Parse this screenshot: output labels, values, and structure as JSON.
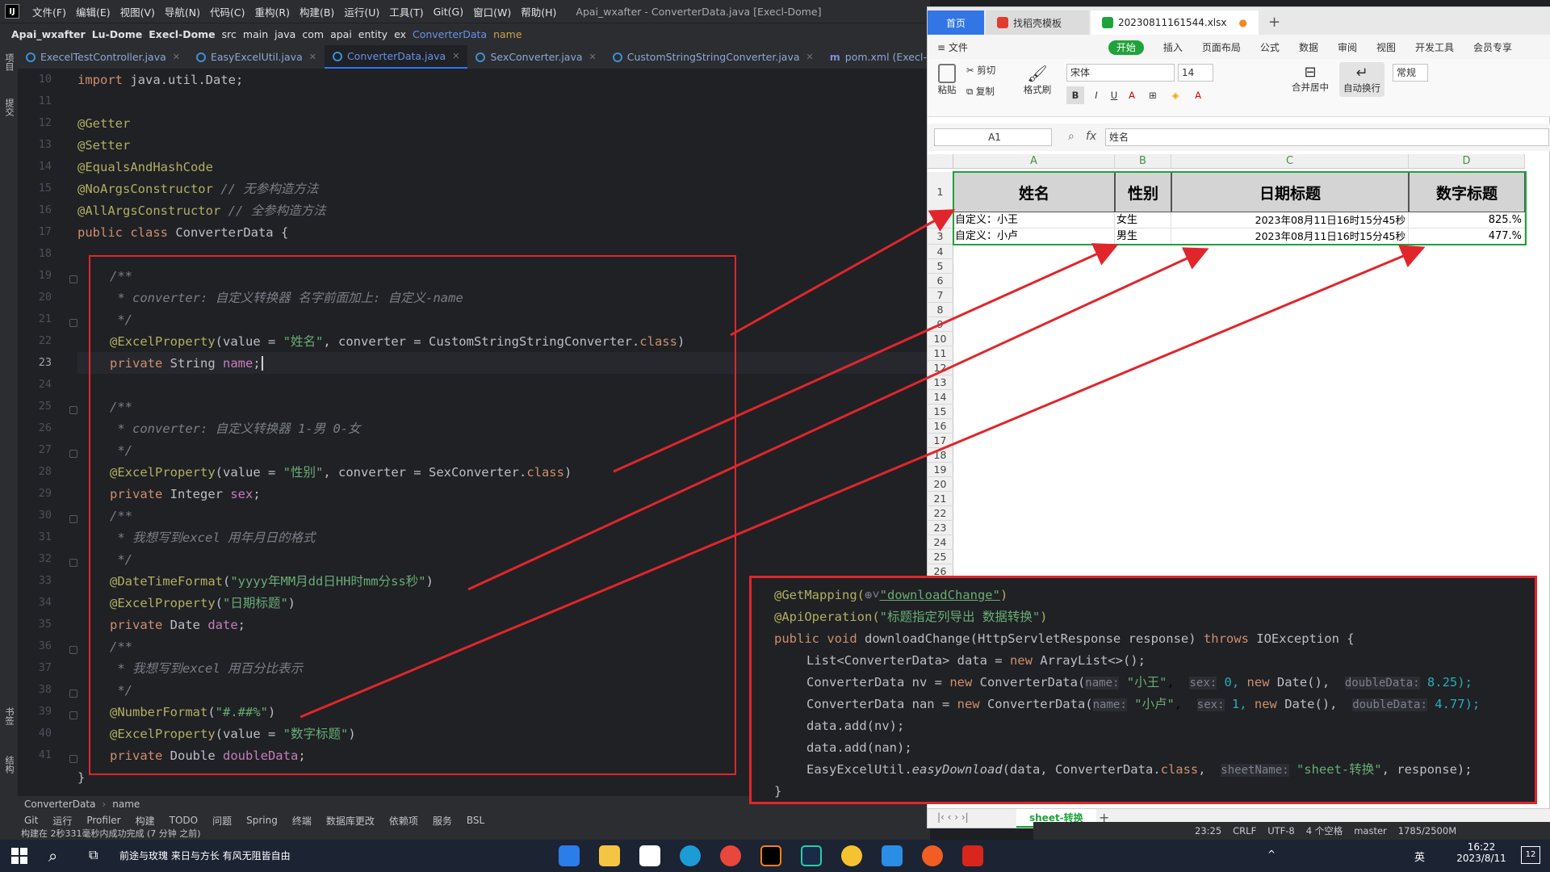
{
  "ide": {
    "logo": "IJ",
    "menu": [
      "文件(F)",
      "编辑(E)",
      "视图(V)",
      "导航(N)",
      "代码(C)",
      "重构(R)",
      "构建(B)",
      "运行(U)",
      "工具(T)",
      "Git(G)",
      "窗口(W)",
      "帮助(H)"
    ],
    "window_title": "Apai_wxafter - ConverterData.java [Execl-Dome]",
    "breadcrumbs": [
      "Apai_wxafter",
      "Lu-Dome",
      "Execl-Dome",
      "src",
      "main",
      "java",
      "com",
      "apai",
      "entity",
      "ex",
      "ConverterData",
      "name"
    ],
    "tabs": [
      "ExecelTestController.java",
      "EasyExcelUtil.java",
      "ConverterData.java",
      "SexConverter.java",
      "CustomStringStringConverter.java",
      "pom.xml (Execl-Dome)"
    ],
    "active_tab": "ConverterData.java",
    "left_tools": [
      "项目",
      "提交",
      "书签",
      "结构"
    ],
    "line_numbers": [
      "10",
      "11",
      "12",
      "13",
      "14",
      "15",
      "16",
      "17",
      "18",
      "19",
      "20",
      "21",
      "22",
      "23",
      "24",
      "25",
      "26",
      "27",
      "28",
      "29",
      "30",
      "31",
      "32",
      "33",
      "34",
      "35",
      "36",
      "37",
      "38",
      "39",
      "40",
      "41"
    ],
    "code": {
      "l10": {
        "kw": "import",
        "rest": " java.util.Date;"
      },
      "l12": "@Getter",
      "l13": "@Setter",
      "l14": "@EqualsAndHashCode",
      "l15a": "@NoArgsConstructor",
      "l15b": " // 无参构造方法",
      "l16a": "@AllArgsConstructor",
      "l16b": " // 全参构造方法",
      "l17a": "public class ",
      "l17b": "ConverterData {",
      "l19": "/**",
      "l20": " * converter: 自定义转换器 名字前面加上: 自定义-name",
      "l21": " */",
      "l22a": "@ExcelProperty",
      "l22b": "(value = ",
      "l22c": "\"姓名\"",
      "l22d": ", converter = ",
      "l22e": "CustomStringStringConverter.",
      "l22f": "class",
      "l22g": ")",
      "l23a": "private ",
      "l23b": "String ",
      "l23c": "name",
      "l23d": ";",
      "l25": "/**",
      "l26": " * converter: 自定义转换器 1-男 0-女",
      "l27": " */",
      "l28a": "@ExcelProperty",
      "l28b": "(value = ",
      "l28c": "\"性别\"",
      "l28d": ", converter = ",
      "l28e": "SexConverter.",
      "l28f": "class",
      "l28g": ")",
      "l29a": "private ",
      "l29b": "Integer ",
      "l29c": "sex",
      "l29d": ";",
      "l30": "/**",
      "l31": " * 我想写到excel 用年月日的格式",
      "l32": " */",
      "l33a": "@DateTimeFormat",
      "l33b": "(",
      "l33c": "\"yyyy年MM月dd日HH时mm分ss秒\"",
      "l33d": ")",
      "l34a": "@ExcelProperty",
      "l34b": "(",
      "l34c": "\"日期标题\"",
      "l34d": ")",
      "l35a": "private ",
      "l35b": "Date ",
      "l35c": "date",
      "l35d": ";",
      "l36": "/**",
      "l37": " * 我想写到excel 用百分比表示",
      "l38": " */",
      "l39a": "@NumberFormat",
      "l39b": "(",
      "l39c": "\"#.##%\"",
      "l39d": ")",
      "l40a": "@ExcelProperty",
      "l40b": "(value = ",
      "l40c": "\"数字标题\"",
      "l40d": ")",
      "l41a": "private ",
      "l41b": "Double ",
      "l41c": "doubleData",
      "l41d": ";",
      "l42": "}"
    },
    "bottom_breadcrumb": [
      "ConverterData",
      "name"
    ],
    "toolbar": [
      "Git",
      "运行",
      "Profiler",
      "构建",
      "TODO",
      "问题",
      "Spring",
      "终端",
      "数据库更改",
      "依赖项",
      "服务",
      "BSL"
    ],
    "status": "构建在 2秒331毫秒内成功完成 (7 分钟 之前)",
    "right_status": [
      "23:25",
      "CRLF",
      "UTF-8",
      "4 个空格",
      "master",
      "1785/2500M"
    ]
  },
  "wps": {
    "tabs": [
      "首页",
      "找稻壳模板",
      "20230811161544.xlsx"
    ],
    "menu": [
      "≡ 文件",
      "开始",
      "插入",
      "页面布局",
      "公式",
      "数据",
      "审阅",
      "视图",
      "开发工具",
      "会员专享"
    ],
    "ribbon": {
      "paste": "粘贴",
      "cut": "剪切",
      "copy": "复制",
      "format_painter": "格式刷",
      "font_name": "宋体",
      "font_size": "14",
      "merge": "合并居中",
      "wrap": "自动换行",
      "number_format": "常规"
    },
    "name_box": "A1",
    "fx": "fx",
    "formula_value": "姓名",
    "columns": [
      "A",
      "B",
      "C",
      "D"
    ],
    "rows": [
      "1",
      "2",
      "3",
      "4",
      "5",
      "6",
      "7",
      "8",
      "9",
      "10",
      "11",
      "12",
      "13",
      "14",
      "15",
      "16",
      "17",
      "18",
      "19",
      "20",
      "21",
      "22",
      "23",
      "24",
      "25",
      "26"
    ],
    "header_row": [
      "姓名",
      "性别",
      "日期标题",
      "数字标题"
    ],
    "data_rows": [
      [
        "自定义：小王",
        "女生",
        "2023年08月11日16时15分45秒",
        "825.%"
      ],
      [
        "自定义：小卢",
        "男生",
        "2023年08月11日16时15分45秒",
        "477.%"
      ]
    ],
    "sheet_tab": "sheet-转换"
  },
  "popup": {
    "l0": "@GetMapping(",
    "l0b": "\"downloadChange\"",
    "l0c": ")",
    "l1": "@ApiOperation(",
    "l1b": "\"标题指定列导出 数据转换\"",
    "l1c": ")",
    "l2a": "public void ",
    "l2b": "downloadChange(HttpServletResponse response) ",
    "l2c": "throws ",
    "l2d": "IOException {",
    "l3a": "List<ConverterData> data = ",
    "l3b": "new ",
    "l3c": "ArrayList<>();",
    "l4a": "ConverterData nv = ",
    "l4b": "new ",
    "l4c": "ConverterData(",
    "l4h1": "name:",
    "l4s1": "\"小王\"",
    "l4h2": "sex:",
    "l4v2": "0, ",
    "l4n": "new ",
    "l4d": "Date(), ",
    "l4h3": "doubleData:",
    "l4v3": "8.25);",
    "l5a": "ConverterData nan = ",
    "l5b": "new ",
    "l5c": "ConverterData(",
    "l5h1": "name:",
    "l5s1": "\"小卢\"",
    "l5h2": "sex:",
    "l5v2": "1, ",
    "l5n": "new ",
    "l5d": "Date(), ",
    "l5h3": "doubleData:",
    "l5v3": "4.77);",
    "l6": "data.add(nv);",
    "l7": "data.add(nan);",
    "l8a": "EasyExcelUtil.",
    "l8b": "easyDownload",
    "l8c": "(data, ConverterData.",
    "l8d": "class",
    "l8e": ", ",
    "l8h": "sheetName:",
    "l8s": "\"sheet-转换\"",
    "l8f": ", response);",
    "l9": "}"
  },
  "taskbar": {
    "search_text": "前途与玫瑰 来日与方长 有风无阻皆自由",
    "time": "16:22",
    "date": "2023/8/11",
    "ime": "英",
    "notif": "12"
  },
  "colors": {
    "accent_red": "#e0262b",
    "ide_bg": "#1f2125",
    "wps_green": "#1fa23a",
    "wps_blue": "#3276e6"
  }
}
